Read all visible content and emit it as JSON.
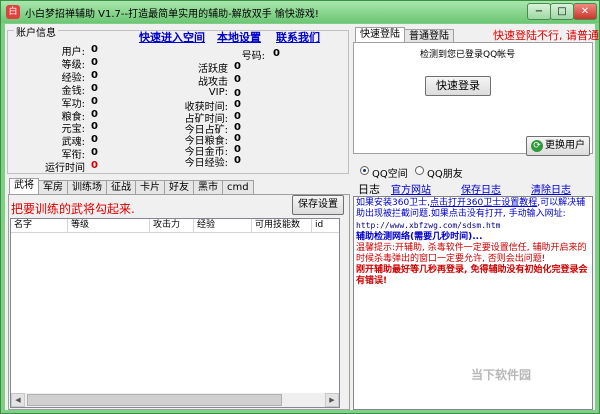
{
  "window": {
    "title": "小白梦招禅辅助 V1.7--打造最简单实用的辅助-解放双手 愉快游戏!",
    "min": "−",
    "max": "□",
    "close": "✕"
  },
  "account": {
    "group_title": "账户信息",
    "fields": [
      {
        "label": "用户:",
        "value": "0"
      },
      {
        "label": "等级:",
        "value": "0"
      },
      {
        "label": "经验:",
        "value": "0"
      },
      {
        "label": "金钱:",
        "value": "0"
      },
      {
        "label": "军功:",
        "value": "0"
      },
      {
        "label": "粮食:",
        "value": "0"
      },
      {
        "label": "元宝:",
        "value": "0"
      },
      {
        "label": "武魂:",
        "value": "0"
      },
      {
        "label": "军衔:",
        "value": "0"
      },
      {
        "label": "运行时间",
        "value": "0"
      }
    ],
    "links": {
      "quick_enter": "快速进入空间",
      "local_settings": "本地设置",
      "contact_us": "联系我们"
    },
    "fields_right": [
      {
        "label": "号码:",
        "value": "0"
      },
      {
        "label": "活跃度",
        "value": "0"
      },
      {
        "label": "战攻击",
        "value": "0"
      },
      {
        "label": "VIP:",
        "value": "0"
      },
      {
        "label": "收获时间:",
        "value": "0"
      },
      {
        "label": "占矿时间:",
        "value": "0"
      },
      {
        "label": "今日占矿:",
        "value": "0"
      },
      {
        "label": "今日粮食:",
        "value": "0"
      },
      {
        "label": "今日金币:",
        "value": "0"
      },
      {
        "label": "今日经验:",
        "value": "0"
      }
    ]
  },
  "login": {
    "tabs": [
      "快速登陆",
      "普通登陆"
    ],
    "notice": "快速登陆不行, 请普通",
    "detected": "检测到您已登录QQ帐号",
    "quick_login_button": "快速登录",
    "switch_user_button": "更换用户"
  },
  "main_tabs": [
    "武将",
    "军房",
    "训练场",
    "征战",
    "卡片",
    "好友",
    "黑市",
    "cmd"
  ],
  "general": {
    "hint": "把要训练的武将勾起来.",
    "save_button": "保存设置",
    "columns": [
      "名字",
      "等级",
      "攻击力",
      "经验",
      "可用技能数",
      "id"
    ]
  },
  "radios": [
    {
      "label": "QQ空间",
      "checked": true
    },
    {
      "label": "QQ朋友",
      "checked": false
    }
  ],
  "log": {
    "label": "日志",
    "links": {
      "website": "官方网站",
      "save": "保存日志",
      "clear": "清除日志"
    },
    "lines": [
      {
        "style": "l-blue",
        "text": "如果安装360卫士,"
      },
      {
        "style": "l-ul",
        "text": "点击打开360卫士设置教程"
      },
      {
        "style": "l-blue",
        "text": ",可以解决辅助出现被拦截问题.如果点击没有打开, 手动输入网址:"
      },
      {
        "style": "l-mono",
        "text": "http://www.xbfzwg.com/sdsm.htm"
      },
      {
        "style": "l-blueb",
        "text": "辅助检测网络(需要几秒时间)..."
      },
      {
        "style": "l-red",
        "text": "温馨提示:开辅助, 杀毒软件一定要设置信任, 辅助开启来的时候杀毒弹出的窗口一定要允许, 否则会出问题!"
      },
      {
        "style": "l-redb",
        "text": "刚开辅助最好等几秒再登录, 免得辅助没有初始化完登录会有错误!"
      }
    ]
  },
  "watermark": "当下软件园"
}
